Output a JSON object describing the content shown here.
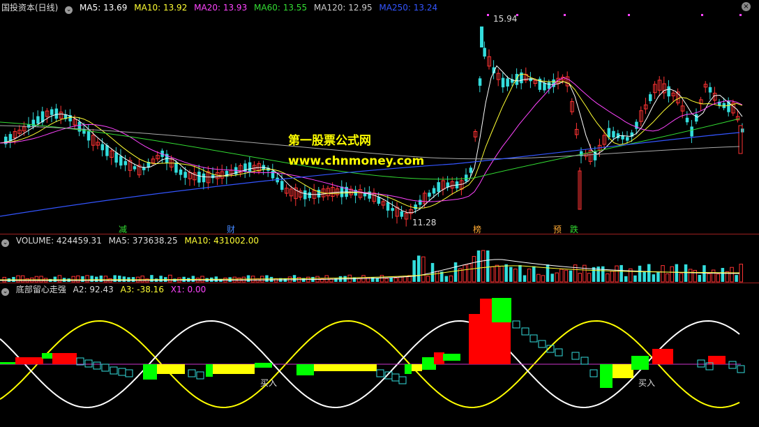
{
  "main": {
    "title": "国投资本(日线)",
    "ma": [
      {
        "label": "MA5: 13.69",
        "color": "#ffffff"
      },
      {
        "label": "MA10: 13.92",
        "color": "#ffff33"
      },
      {
        "label": "MA20: 13.93",
        "color": "#ff44ff"
      },
      {
        "label": "MA60: 13.55",
        "color": "#33dd33"
      },
      {
        "label": "MA120: 12.95",
        "color": "#cccccc"
      },
      {
        "label": "MA250: 13.24",
        "color": "#3355ff"
      }
    ],
    "high_label": "15.94",
    "low_label": "11.28",
    "event_tags": [
      {
        "text": "减",
        "color": "#33dd33"
      },
      {
        "text": "财",
        "color": "#4488ff"
      },
      {
        "text": "榜",
        "color": "#ffaa33"
      },
      {
        "text": "预",
        "color": "#ffaa33"
      },
      {
        "text": "跌",
        "color": "#33dd33"
      }
    ]
  },
  "watermark": {
    "title": "第一股票公式网",
    "url": "www.chnmoney.com"
  },
  "volume": {
    "label": "VOLUME: 424459.31",
    "ma5": "MA5: 373638.25",
    "ma10": "MA10: 431002.00"
  },
  "indicator": {
    "name": "底部留心走强",
    "a2": "A2: 92.43",
    "a3": "A3: -38.16",
    "x1": "X1: 0.00",
    "buy_label_1": "买入",
    "buy_label_2": "买入"
  },
  "colors": {
    "up": "#ff3333",
    "down": "#33dddd",
    "bar_red": "#ff0000",
    "bar_green": "#00ff00",
    "bar_yellow": "#ffff00",
    "watermark": "#ffff00"
  }
}
